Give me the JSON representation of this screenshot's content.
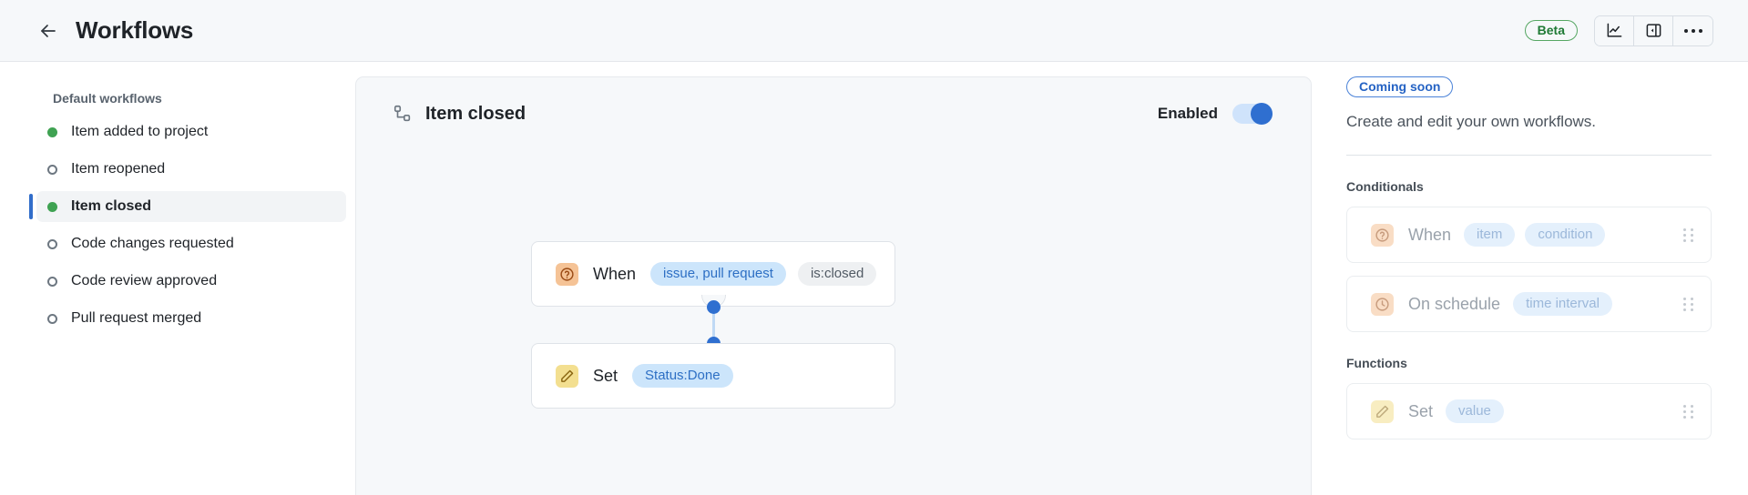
{
  "header": {
    "back_icon": "arrow-left-icon",
    "title": "Workflows",
    "beta_label": "Beta",
    "insights_icon": "line-chart-icon",
    "panel_icon": "side-panel-icon",
    "more_icon": "kebab-menu-icon"
  },
  "sidebar": {
    "heading": "Default workflows",
    "items": [
      {
        "label": "Item added to project",
        "enabled": true,
        "selected": false
      },
      {
        "label": "Item reopened",
        "enabled": false,
        "selected": false
      },
      {
        "label": "Item closed",
        "enabled": true,
        "selected": true
      },
      {
        "label": "Code changes requested",
        "enabled": false,
        "selected": false
      },
      {
        "label": "Code review approved",
        "enabled": false,
        "selected": false
      },
      {
        "label": "Pull request merged",
        "enabled": false,
        "selected": false
      }
    ]
  },
  "canvas": {
    "workflow_icon": "workflow-branch-icon",
    "title": "Item closed",
    "enabled_label": "Enabled",
    "toggle_on": true,
    "nodes": [
      {
        "icon": "question-mark-icon",
        "verb": "When",
        "pills": [
          {
            "text": "issue, pull request",
            "style": "blue"
          },
          {
            "text": "is:closed",
            "style": "gray"
          }
        ]
      },
      {
        "icon": "pencil-icon",
        "verb": "Set",
        "pills": [
          {
            "text": "Status:Done",
            "style": "blue"
          }
        ]
      }
    ]
  },
  "right_panel": {
    "coming_soon_label": "Coming soon",
    "description": "Create and edit your own workflows.",
    "conditionals_heading": "Conditionals",
    "conditionals": [
      {
        "icon": "question-mark-icon",
        "verb": "When",
        "pills": [
          "item",
          "condition"
        ]
      },
      {
        "icon": "clock-icon",
        "verb": "On schedule",
        "pills": [
          "time interval"
        ]
      }
    ],
    "functions_heading": "Functions",
    "functions": [
      {
        "icon": "pencil-icon",
        "verb": "Set",
        "pills": [
          "value"
        ]
      }
    ]
  },
  "colors": {
    "accent_blue": "#2f6fd0",
    "enabled_green": "#3fa252",
    "beta_green": "#1f7a35",
    "canvas_bg": "#f6f8fa"
  }
}
